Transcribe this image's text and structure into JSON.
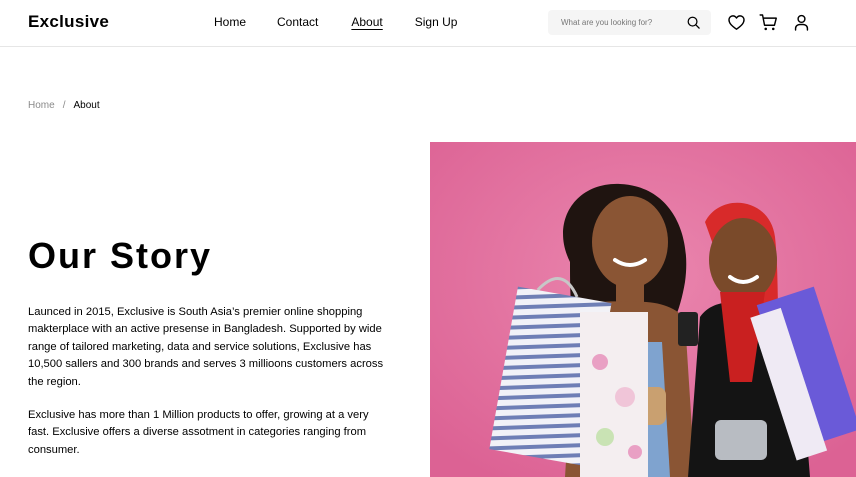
{
  "header": {
    "logo": "Exclusive",
    "nav": [
      {
        "label": "Home"
      },
      {
        "label": "Contact"
      },
      {
        "label": "About",
        "active": true
      },
      {
        "label": "Sign Up"
      }
    ],
    "search": {
      "placeholder": "What are you looking for?",
      "icon": "search-icon"
    },
    "icons": [
      "heart-icon",
      "cart-icon",
      "user-icon"
    ]
  },
  "breadcrumb": {
    "home": "Home",
    "separator": "/",
    "current": "About"
  },
  "story": {
    "title": "Our Story",
    "paragraph1": "Launced in 2015, Exclusive is South Asia’s premier online shopping makterplace with an active presense in Bangladesh. Supported by wide range of tailored marketing, data and service solutions, Exclusive has 10,500 sallers and 300 brands and serves 3 millioons customers across the region.",
    "paragraph2": "Exclusive has more than 1 Million products to offer, growing at a very fast. Exclusive offers a diverse assotment in categories ranging  from consumer."
  },
  "colors": {
    "hero_background": "#e5709f",
    "search_background": "#f5f5f5"
  }
}
